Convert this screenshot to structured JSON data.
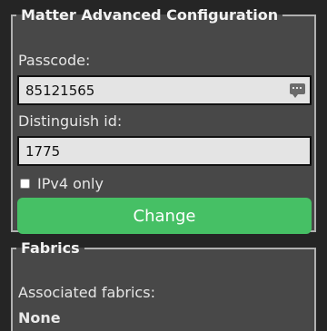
{
  "config": {
    "legend": "Matter Advanced Configuration",
    "passcode_label": "Passcode:",
    "passcode_value": "85121565",
    "passcode_icon": "keyboard-suggest-icon",
    "distinguish_label": "Distinguish id:",
    "distinguish_value": "1775",
    "ipv4_label": "IPv4 only",
    "ipv4_checked": false,
    "change_button": "Change"
  },
  "fabrics": {
    "legend": "Fabrics",
    "associated_label": "Associated fabrics:",
    "associated_value": "None"
  },
  "colors": {
    "page_background": "#252525",
    "panel_background": "#484848",
    "button_green": "#46c065"
  }
}
